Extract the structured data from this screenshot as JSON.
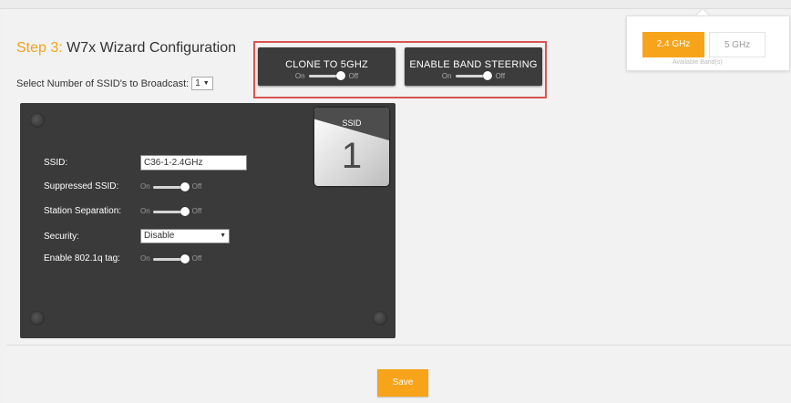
{
  "header": {
    "step_label": "Step 3:",
    "title": "W7x Wizard Configuration"
  },
  "ssid_count": {
    "label": "Select Number of SSID's to Broadcast:",
    "value": "1"
  },
  "actions": {
    "clone_label": "CLONE TO 5GHZ",
    "band_steering_label": "ENABLE BAND STEERING",
    "on_label": "On",
    "off_label": "Off"
  },
  "bands": {
    "active": "2.4 GHz",
    "inactive": "5 GHz",
    "caption": "Available Band(s)"
  },
  "ssid_card": {
    "badge_label": "SSID",
    "badge_number": "1",
    "fields": {
      "ssid_label": "SSID:",
      "ssid_value": "C36-1-2.4GHz",
      "suppressed_label": "Suppressed SSID:",
      "station_sep_label": "Station Separation:",
      "security_label": "Security:",
      "security_value": "Disable",
      "vlan_label": "Enable 802.1q tag:"
    }
  },
  "footer": {
    "save_label": "Save"
  },
  "colors": {
    "accent": "#f7a41a",
    "card_bg": "#3a3a3a",
    "highlight_border": "#d9534f"
  }
}
